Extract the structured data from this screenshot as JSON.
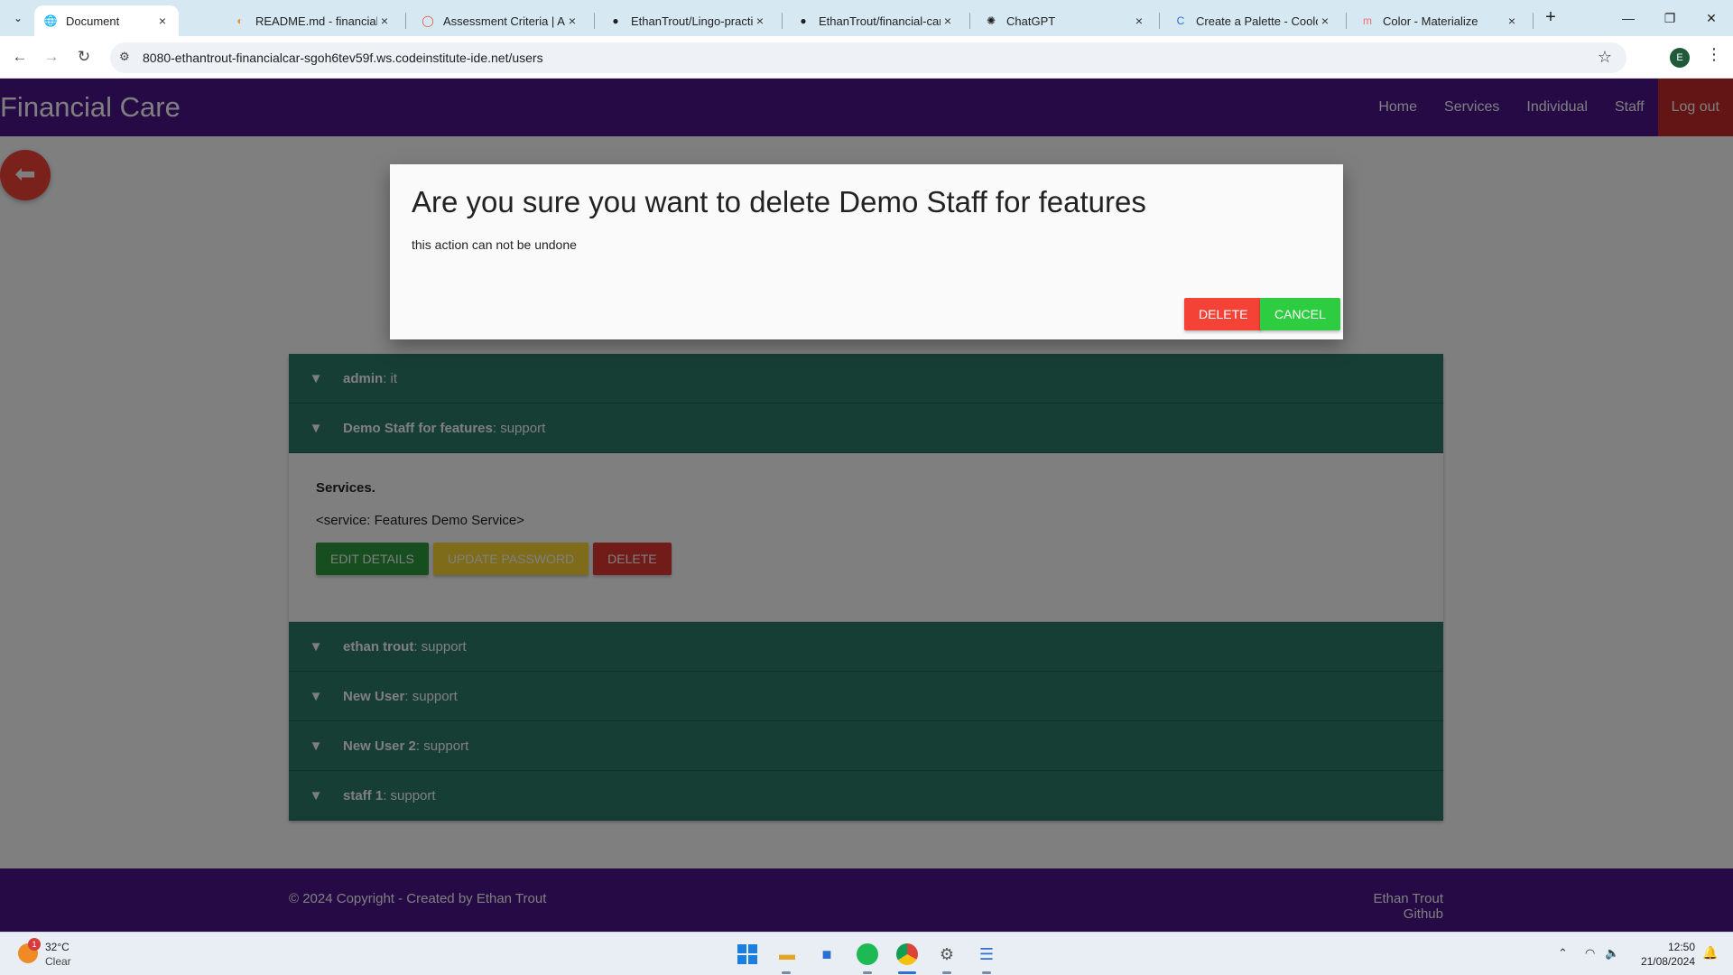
{
  "browser": {
    "tabs": [
      {
        "title": "Document",
        "favicon": "globe-icon"
      },
      {
        "title": "README.md - financial-ca",
        "favicon": "gitpod-icon"
      },
      {
        "title": "Assessment Criteria | Acti",
        "favicon": "assessment-icon"
      },
      {
        "title": "EthanTrout/Lingo-practice",
        "favicon": "github-icon"
      },
      {
        "title": "EthanTrout/financial-care",
        "favicon": "github-icon"
      },
      {
        "title": "ChatGPT",
        "favicon": "chatgpt-icon"
      },
      {
        "title": "Create a Palette - Coolors",
        "favicon": "coolors-icon"
      },
      {
        "title": "Color - Materialize",
        "favicon": "materialize-icon"
      }
    ],
    "url": "8080-ethantrout-financialcar-sgoh6tev59f.ws.codeinstitute-ide.net/users",
    "profile_initial": "E"
  },
  "site": {
    "brand": "Financial Care",
    "nav": [
      "Home",
      "Services",
      "Individual",
      "Staff",
      "Log out"
    ],
    "colors": {
      "primary": "#4a148c",
      "teal": "#2e7d6b",
      "logout": "#c62828"
    }
  },
  "modal": {
    "title": "Are you sure you want to delete Demo Staff for features",
    "subtitle": "this action can not be undone",
    "delete_label": "Delete",
    "cancel_label": "Cancel"
  },
  "staff_list": [
    {
      "name": "admin",
      "role": "it",
      "expanded": false
    },
    {
      "name": "Demo Staff for features",
      "role": "support",
      "expanded": true
    },
    {
      "name": "ethan trout",
      "role": "support",
      "expanded": false
    },
    {
      "name": "New User",
      "role": "support",
      "expanded": false
    },
    {
      "name": "New User 2",
      "role": "support",
      "expanded": false
    },
    {
      "name": "staff 1",
      "role": "support",
      "expanded": false
    }
  ],
  "expanded_panel": {
    "services_title": "Services.",
    "service_item": "<service: Features Demo Service>",
    "edit_label": "Edit Details",
    "update_password_label": "Update Password",
    "delete_label": "Delete"
  },
  "footer": {
    "copyright": "© 2024 Copyright - Created by Ethan Trout",
    "github": "Ethan Trout Github"
  },
  "taskbar": {
    "weather_badge": "1",
    "temperature": "32°C",
    "condition": "Clear",
    "time": "12:50",
    "date": "21/08/2024"
  }
}
